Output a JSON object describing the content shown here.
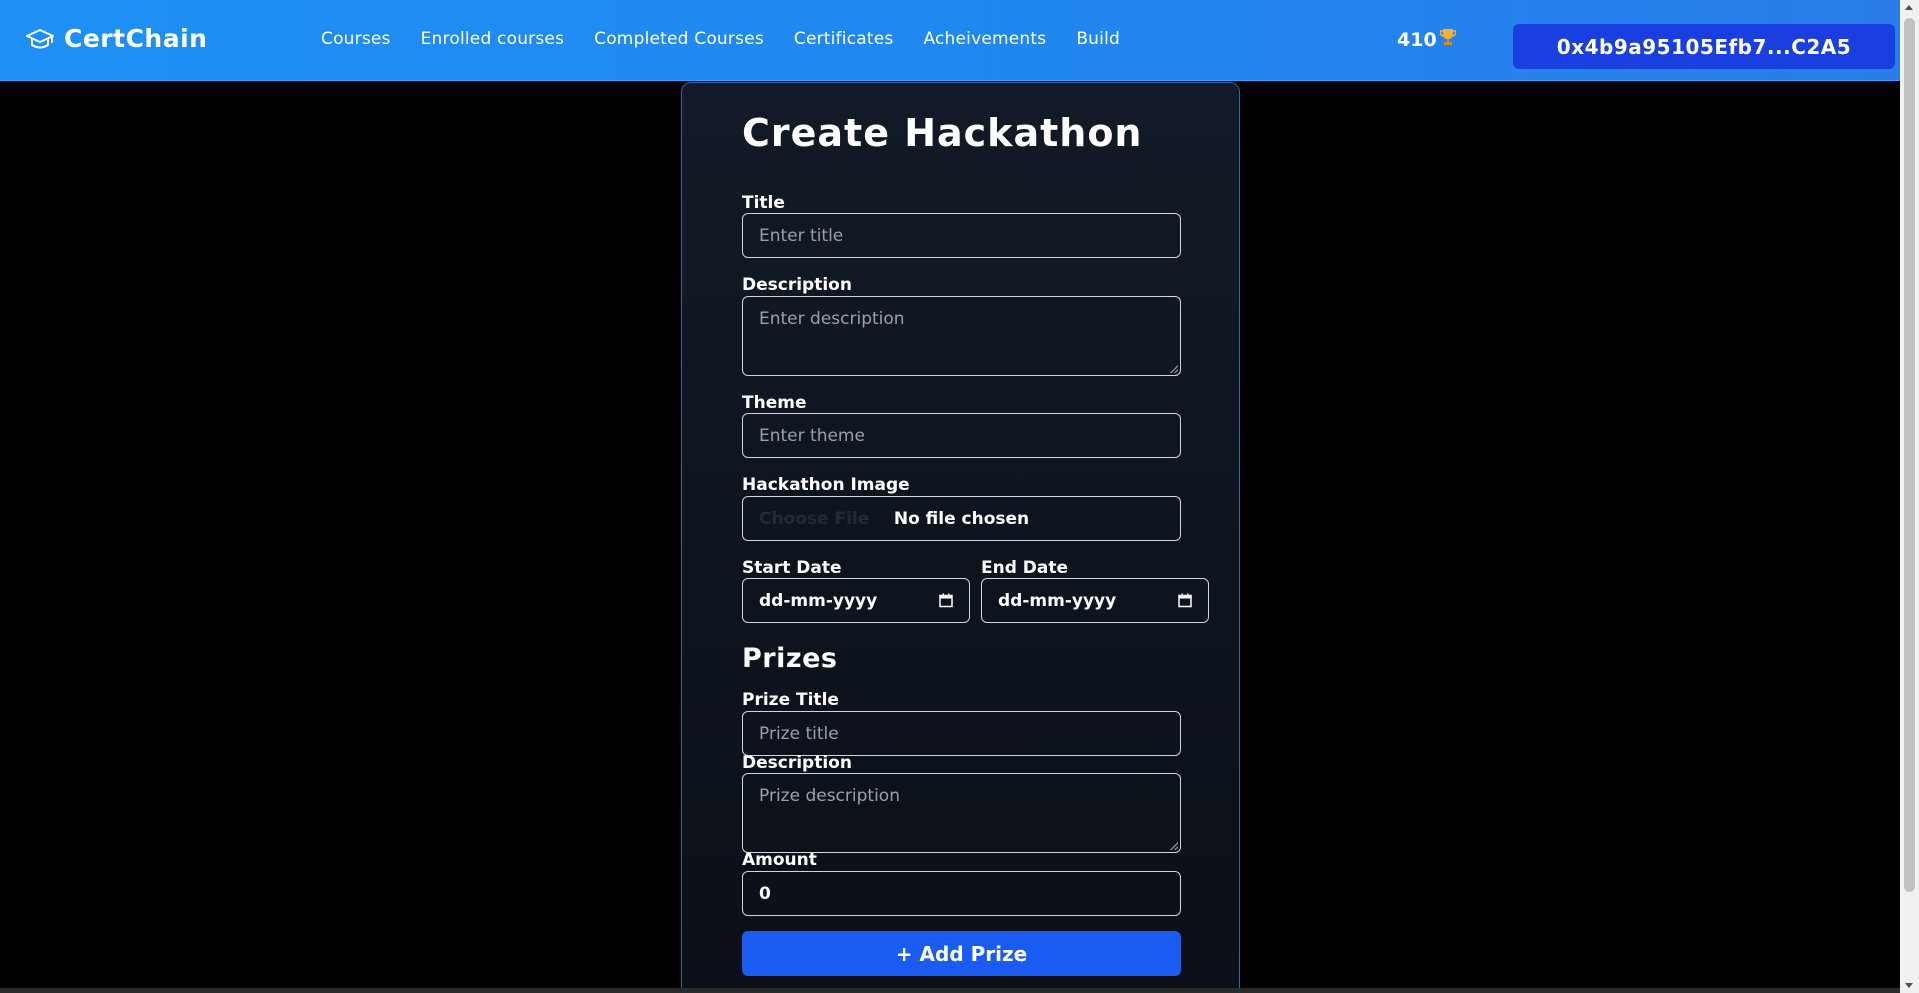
{
  "header": {
    "brand": "CertChain",
    "nav": [
      "Courses",
      "Enrolled courses",
      "Completed Courses",
      "Certificates",
      "Acheivements",
      "Build"
    ],
    "points": "410",
    "wallet": "0x4b9a95105Efb7...C2A5"
  },
  "form": {
    "title": "Create Hackathon",
    "title_label": "Title",
    "title_placeholder": "Enter title",
    "description_label": "Description",
    "description_placeholder": "Enter description",
    "theme_label": "Theme",
    "theme_placeholder": "Enter theme",
    "image_label": "Hackathon Image",
    "image_choose": "Choose File",
    "image_status": "No file chosen",
    "start_label": "Start Date",
    "start_value": "dd-mm-yyyy",
    "end_label": "End Date",
    "end_value": "dd-mm-yyyy"
  },
  "prizes": {
    "heading": "Prizes",
    "title_label": "Prize Title",
    "title_placeholder": "Prize title",
    "description_label": "Description",
    "description_placeholder": "Prize description",
    "amount_label": "Amount",
    "amount_value": "0",
    "add_button": "+ Add Prize"
  },
  "colors": {
    "accent": "#1a5cf2",
    "wallet": "#1a3fe0",
    "card_border": "#1b6fa8"
  }
}
